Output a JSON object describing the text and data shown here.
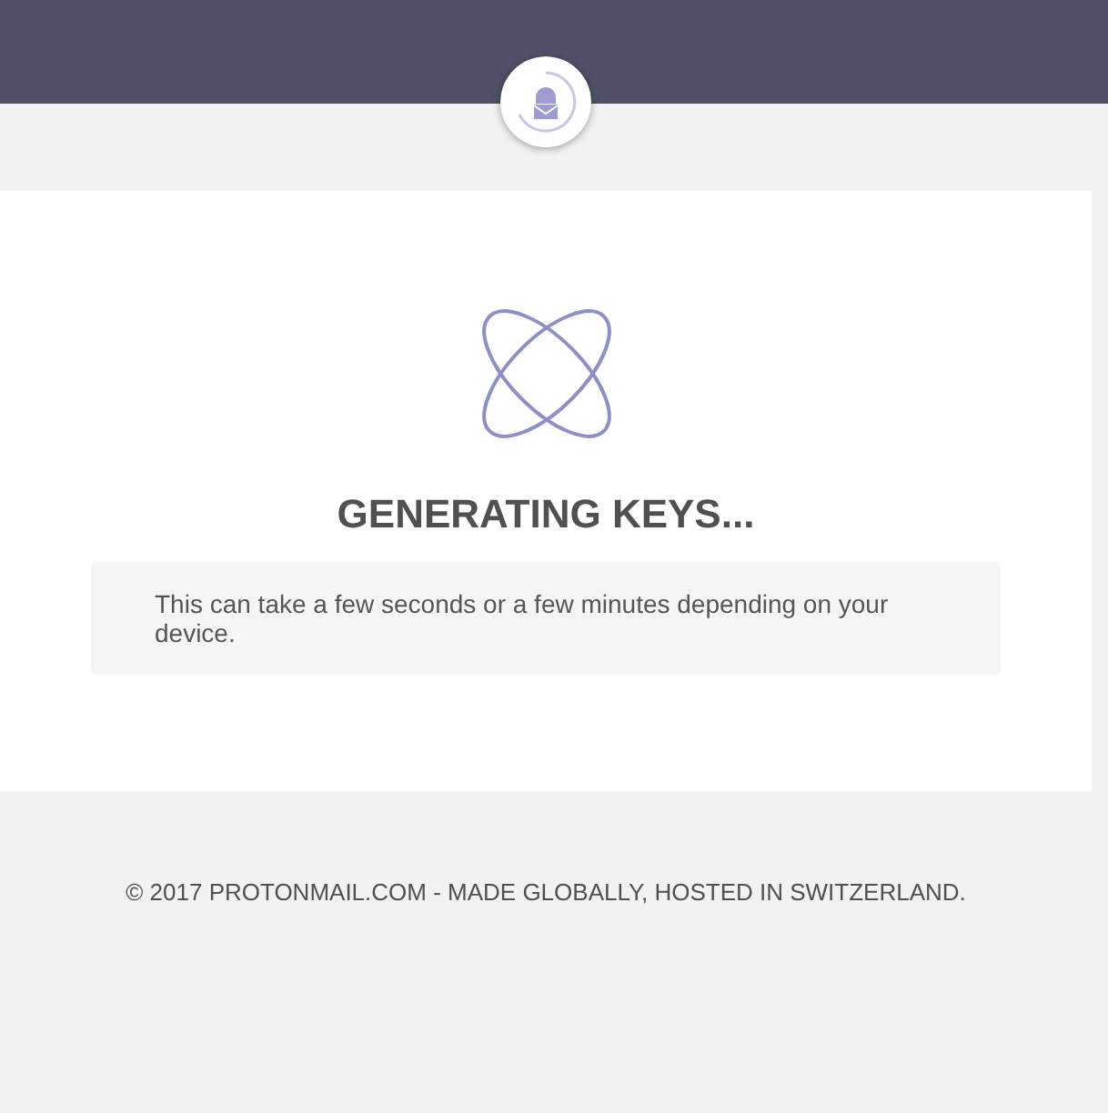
{
  "loading": {
    "title": "GENERATING KEYS...",
    "message": "This can take a few seconds or a few minutes depending on your device."
  },
  "footer": {
    "text": "© 2017 PROTONMAIL.COM - MADE GLOBALLY, HOSTED IN SWITZERLAND."
  }
}
